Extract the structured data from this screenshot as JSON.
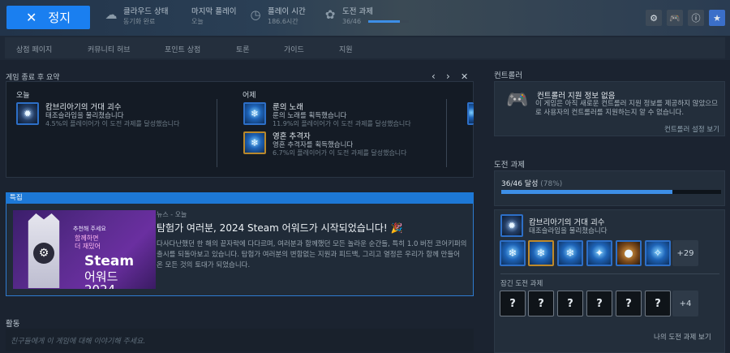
{
  "topbar": {
    "stop_label": "정지",
    "cloud_status_label": "클라우드 상태",
    "cloud_status_value": "동기화 완료",
    "last_played_label": "마지막 플레이",
    "last_played_value": "오늘",
    "playtime_label": "플레이 시간",
    "playtime_value": "186.6시간",
    "achievements_label": "도전 과제",
    "achievements_value": "36/46",
    "achievements_progress": 0.78
  },
  "nav": {
    "tabs": [
      "상점 페이지",
      "커뮤니티 허브",
      "포인트 상점",
      "토론",
      "가이드",
      "지원"
    ]
  },
  "post_game_summary": {
    "title": "게임 종료 후 요약",
    "today_label": "오늘",
    "yesterday_label": "어제",
    "today_items": [
      {
        "name": "캄브리아기의 거대 괴수",
        "desc": "태조슬라임을 물리쳤습니다",
        "pct": "4.5%의 플레이어가 이 도전 과제를 달성했습니다"
      }
    ],
    "yesterday_items": [
      {
        "name": "룬의 노래",
        "desc": "룬의 노래를 획득했습니다",
        "pct": "11.9%의 플레이어가 이 도전 과제를 달성했습니다"
      },
      {
        "name": "영혼 추격자",
        "desc": "영혼 추격자를 획득했습니다",
        "pct": "6.7%의 플레이어가 이 도전 과제를 달성했습니다"
      }
    ]
  },
  "featured": {
    "label": "특집",
    "kicker": "뉴스 - 오늘",
    "title": "탐험가 여러분, 2024 Steam 어워드가 시작되었습니다! 🎉",
    "body": "다사다난했던 한 해의 끝자락에 다다르며, 여러분과 함께했던 모든 놀라운 순간들, 특히 1.0 버전 코어키퍼의 출시를 되돌아보고 있습니다. 탐험가 여러분의 변함없는 지원과 피드백, 그리고 열정은 우리가 함께 만들어 온 모든 것의 토대가 되었습니다.",
    "image_text": {
      "small": "추천해 주세요",
      "pink": "함께하면\n더 재밌어",
      "steam": "Steam",
      "award": "어워드",
      "year": "2024"
    }
  },
  "activity": {
    "title": "활동",
    "placeholder": "친구들에게 이 게임에 대해 이야기해 주세요."
  },
  "controller": {
    "section_title": "컨트롤러",
    "heading": "컨트롤러 지원 정보 없음",
    "desc": "이 게임은 아직 새로운 컨트롤러 지원 정보를 제공하지 않았으므로 사용자의 컨트롤러를 지원하는지 알 수 없습니다.",
    "link": "컨트롤러 설정 보기"
  },
  "achievements": {
    "section_title": "도전 과제",
    "progress_text": "36/46 달성",
    "progress_pct": "(78%)",
    "progress": 0.78,
    "latest_name": "캄브리아기의 거대 괴수",
    "latest_desc": "태조슬라임을 물리쳤습니다",
    "more_unlocked": "+29",
    "hidden_title": "잠긴 도전 과제",
    "locked_glyph": "?",
    "more_locked": "+4",
    "view_link": "나의 도전 과제 보기"
  },
  "icons": {
    "cloud": "cloud-check-icon",
    "calendar": "calendar-icon",
    "clock": "clock-icon",
    "trophy": "trophy-icon",
    "settings": "gear-icon",
    "controller": "gamepad-icon",
    "info": "info-icon",
    "favorite": "star-icon"
  },
  "colors": {
    "accent": "#1a7ff0",
    "progress": "#3d8ee6",
    "background": "#1b2330"
  }
}
